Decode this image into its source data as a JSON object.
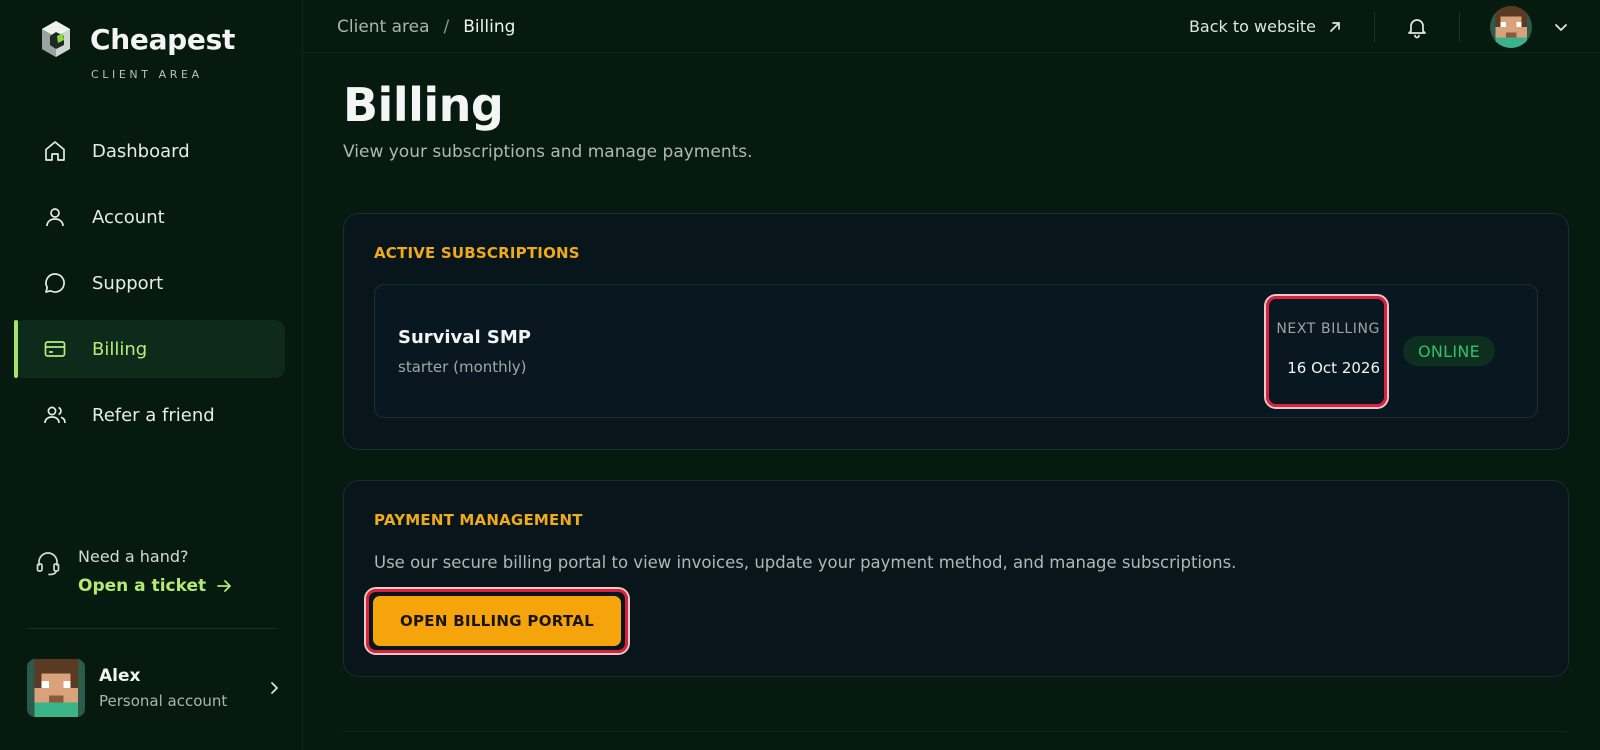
{
  "brand": {
    "name": "Cheapest",
    "subtitle": "CLIENT AREA"
  },
  "sidebar": {
    "items": [
      {
        "label": "Dashboard",
        "icon": "home-icon",
        "active": false
      },
      {
        "label": "Account",
        "icon": "user-icon",
        "active": false
      },
      {
        "label": "Support",
        "icon": "chat-bubble-icon",
        "active": false
      },
      {
        "label": "Billing",
        "icon": "credit-card-icon",
        "active": true
      },
      {
        "label": "Refer a friend",
        "icon": "users-icon",
        "active": false
      }
    ],
    "help": {
      "title": "Need a hand?",
      "link": "Open a ticket"
    },
    "profile": {
      "name": "Alex",
      "subtitle": "Personal account"
    }
  },
  "topbar": {
    "breadcrumb": {
      "root": "Client area",
      "separator": "/",
      "current": "Billing"
    },
    "back_link": "Back to website"
  },
  "page": {
    "title": "Billing",
    "subtitle": "View your subscriptions and manage payments."
  },
  "subscriptions": {
    "heading": "ACTIVE SUBSCRIPTIONS",
    "items": [
      {
        "name": "Survival SMP",
        "plan": "starter (monthly)",
        "next_billing_label": "NEXT BILLING",
        "next_billing_date": "16 Oct 2026",
        "status": "ONLINE"
      }
    ]
  },
  "payment": {
    "heading": "PAYMENT MANAGEMENT",
    "description": "Use our secure billing portal to view invoices, update your payment method, and manage subscriptions.",
    "button_label": "OPEN BILLING PORTAL"
  },
  "colors": {
    "background": "#061a10",
    "accent_green": "#b4ea73",
    "accent_orange": "#f5a50b",
    "status_online": "#34c06a",
    "highlight_red": "#d8233c"
  }
}
